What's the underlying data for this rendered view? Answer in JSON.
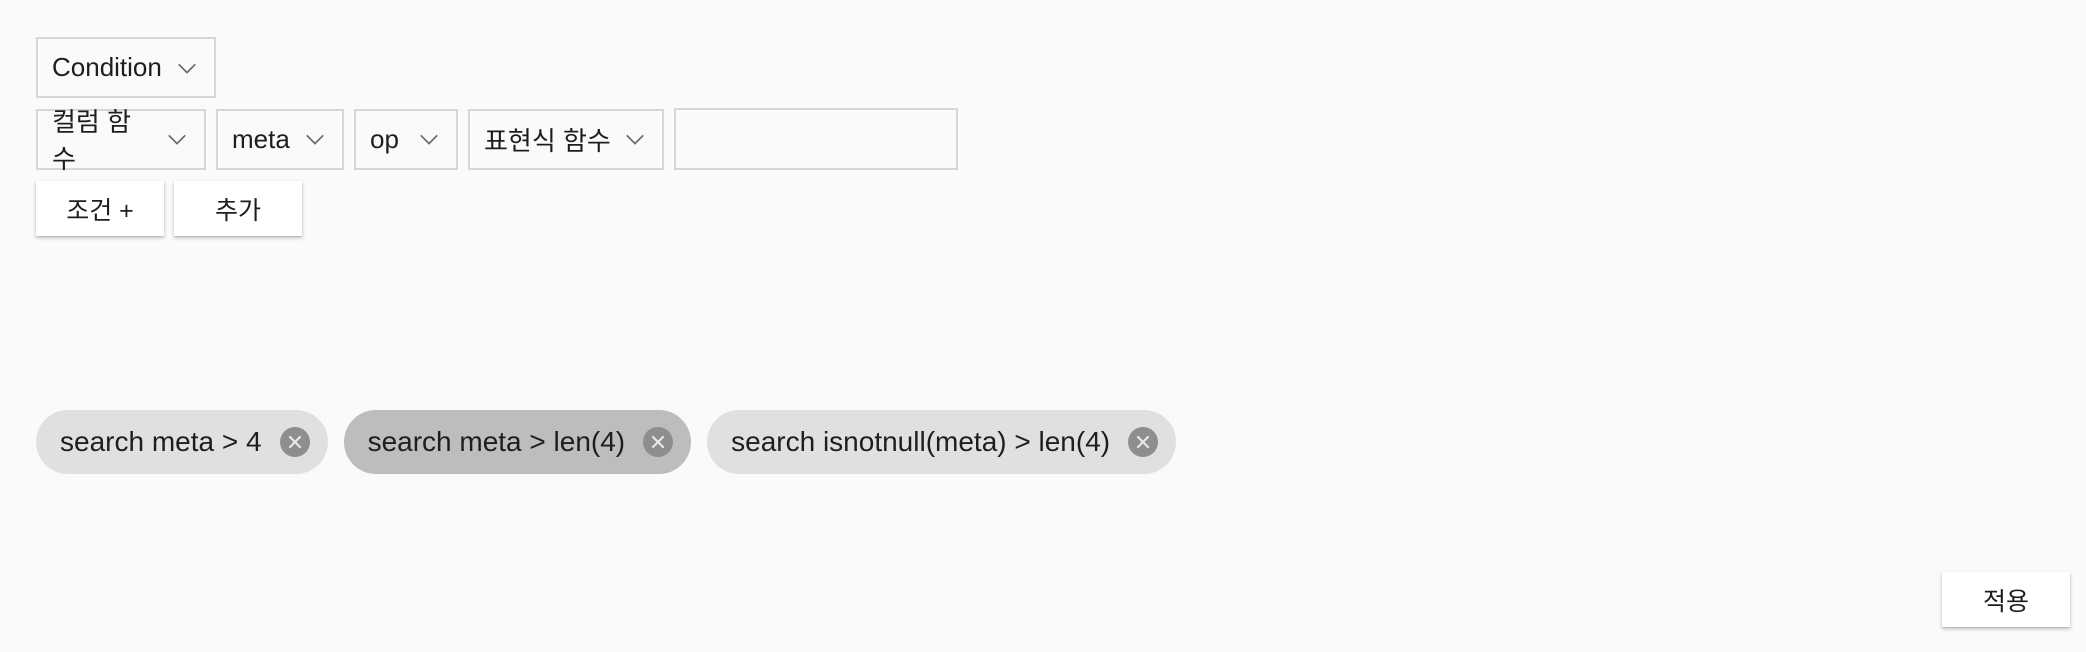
{
  "row1": {
    "condition_select": "Condition"
  },
  "row2": {
    "column_function_select": "컬럼 함수",
    "column_select": "meta",
    "operator_select": "op",
    "expression_function_select": "표현식 함수",
    "value_input": {
      "value": "",
      "placeholder": ""
    }
  },
  "row3": {
    "add_condition_label": "조건 +",
    "add_label": "추가"
  },
  "chips": [
    {
      "label": "search meta > 4",
      "selected": false
    },
    {
      "label": "search meta > len(4)",
      "selected": true
    },
    {
      "label": "search isnotnull(meta) > len(4)",
      "selected": false
    }
  ],
  "footer": {
    "apply_label": "적용"
  },
  "icons": {
    "dropdown": "chevron-down-icon",
    "chip_remove": "close-circle-icon"
  },
  "colors": {
    "background": "#fafafa",
    "chip": "#e0e0e0",
    "chip_selected": "#bdbdbd",
    "chip_close": "#8e8e8e",
    "border": "#d6d6d6"
  }
}
